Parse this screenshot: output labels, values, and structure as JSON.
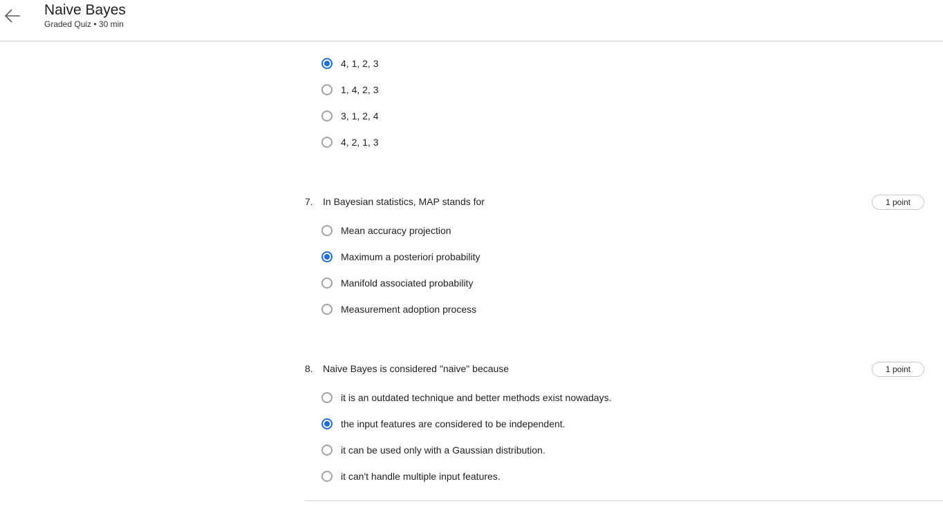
{
  "header": {
    "title": "Naive Bayes",
    "subtitle": "Graded Quiz • 30 min"
  },
  "previous_question": {
    "options": [
      {
        "label": "4, 1, 2, 3",
        "selected": true
      },
      {
        "label": "1, 4, 2, 3",
        "selected": false
      },
      {
        "label": "3, 1, 2, 4",
        "selected": false
      },
      {
        "label": "4, 2, 1, 3",
        "selected": false
      }
    ]
  },
  "questions": [
    {
      "number": "7.",
      "text": "In Bayesian statistics, MAP stands for",
      "points": "1 point",
      "options": [
        {
          "label": "Mean accuracy projection",
          "selected": false
        },
        {
          "label": "Maximum a posteriori probability",
          "selected": true
        },
        {
          "label": "Manifold associated probability",
          "selected": false
        },
        {
          "label": "Measurement adoption process",
          "selected": false
        }
      ]
    },
    {
      "number": "8.",
      "text": "Naive Bayes is considered \"naive\" because",
      "points": "1 point",
      "options": [
        {
          "label": "it is an outdated technique and better methods exist nowadays.",
          "selected": false
        },
        {
          "label": "the input features are considered to be independent.",
          "selected": true
        },
        {
          "label": "it can be used only with a Gaussian distribution.",
          "selected": false
        },
        {
          "label": "it can't handle multiple input features.",
          "selected": false
        }
      ]
    }
  ],
  "colors": {
    "accent": "#1f6cd6",
    "radio_border": "#a2a2a2",
    "divider": "#c9c9c9"
  },
  "icons": {
    "back": "arrow-left-icon"
  }
}
